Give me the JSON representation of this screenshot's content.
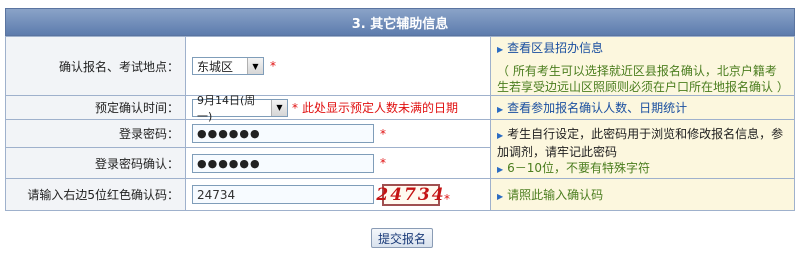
{
  "section": {
    "title": "3. 其它辅助信息"
  },
  "rows": {
    "location": {
      "label": "确认报名、考试地点：",
      "select_value": "东城区",
      "link": "查看区县招办信息",
      "note": "（ 所有考生可以选择就近区县报名确认，北京户籍考生若享受边远山区照顾则必须在户口所在地报名确认 ）"
    },
    "confirm_time": {
      "label": "预定确认时间：",
      "select_value": "9月14日(周一)",
      "hint": "此处显示预定人数未满的日期",
      "link": "查看参加报名确认人数、日期统计"
    },
    "password": {
      "label": "登录密码：",
      "value": "●●●●●●",
      "tip": "考生自行设定，此密码用于浏览和修改报名信息，参加调剂，请牢记此密码",
      "rule": "6－10位，不要有特殊字符"
    },
    "password_confirm": {
      "label": "登录密码确认：",
      "value": "●●●●●●"
    },
    "captcha": {
      "label": "请输入右边5位红色确认码：",
      "value": "24734",
      "image_text": "24734",
      "tip": "请照此输入确认码"
    }
  },
  "required_mark": "*",
  "submit_label": "提交报名",
  "colors": {
    "header": "#6f8bb8",
    "tip_bg": "#fcf7de",
    "label_bg": "#f2f4f7",
    "required": "#e01010",
    "link": "#1a4fa0"
  }
}
